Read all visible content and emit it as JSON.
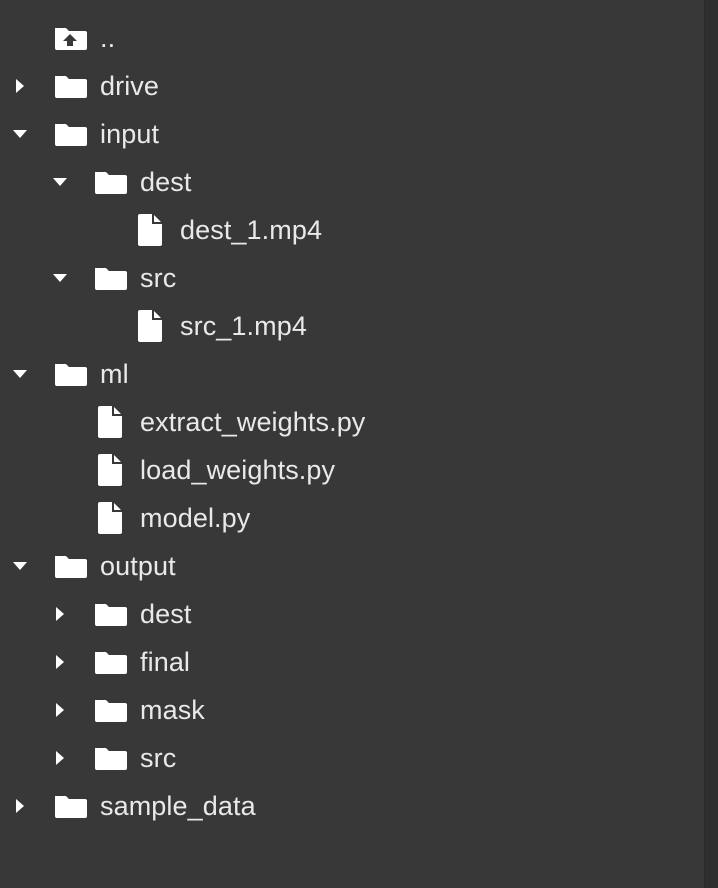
{
  "tree": [
    {
      "label": "..",
      "type": "parent",
      "icon": "folder-up-icon"
    },
    {
      "label": "drive",
      "type": "folder",
      "expanded": false
    },
    {
      "label": "input",
      "type": "folder",
      "expanded": true
    },
    {
      "label": "dest",
      "type": "folder",
      "expanded": true
    },
    {
      "label": "dest_1.mp4",
      "type": "file"
    },
    {
      "label": "src",
      "type": "folder",
      "expanded": true
    },
    {
      "label": "src_1.mp4",
      "type": "file"
    },
    {
      "label": "ml",
      "type": "folder",
      "expanded": true
    },
    {
      "label": "extract_weights.py",
      "type": "file"
    },
    {
      "label": "load_weights.py",
      "type": "file"
    },
    {
      "label": "model.py",
      "type": "file"
    },
    {
      "label": "output",
      "type": "folder",
      "expanded": true
    },
    {
      "label": "dest",
      "type": "folder",
      "expanded": false
    },
    {
      "label": "final",
      "type": "folder",
      "expanded": false
    },
    {
      "label": "mask",
      "type": "folder",
      "expanded": false
    },
    {
      "label": "src",
      "type": "folder",
      "expanded": false
    },
    {
      "label": "sample_data",
      "type": "folder",
      "expanded": false
    }
  ],
  "colors": {
    "background": "#383838",
    "text": "#e9e9e9",
    "icon": "#ffffff"
  }
}
